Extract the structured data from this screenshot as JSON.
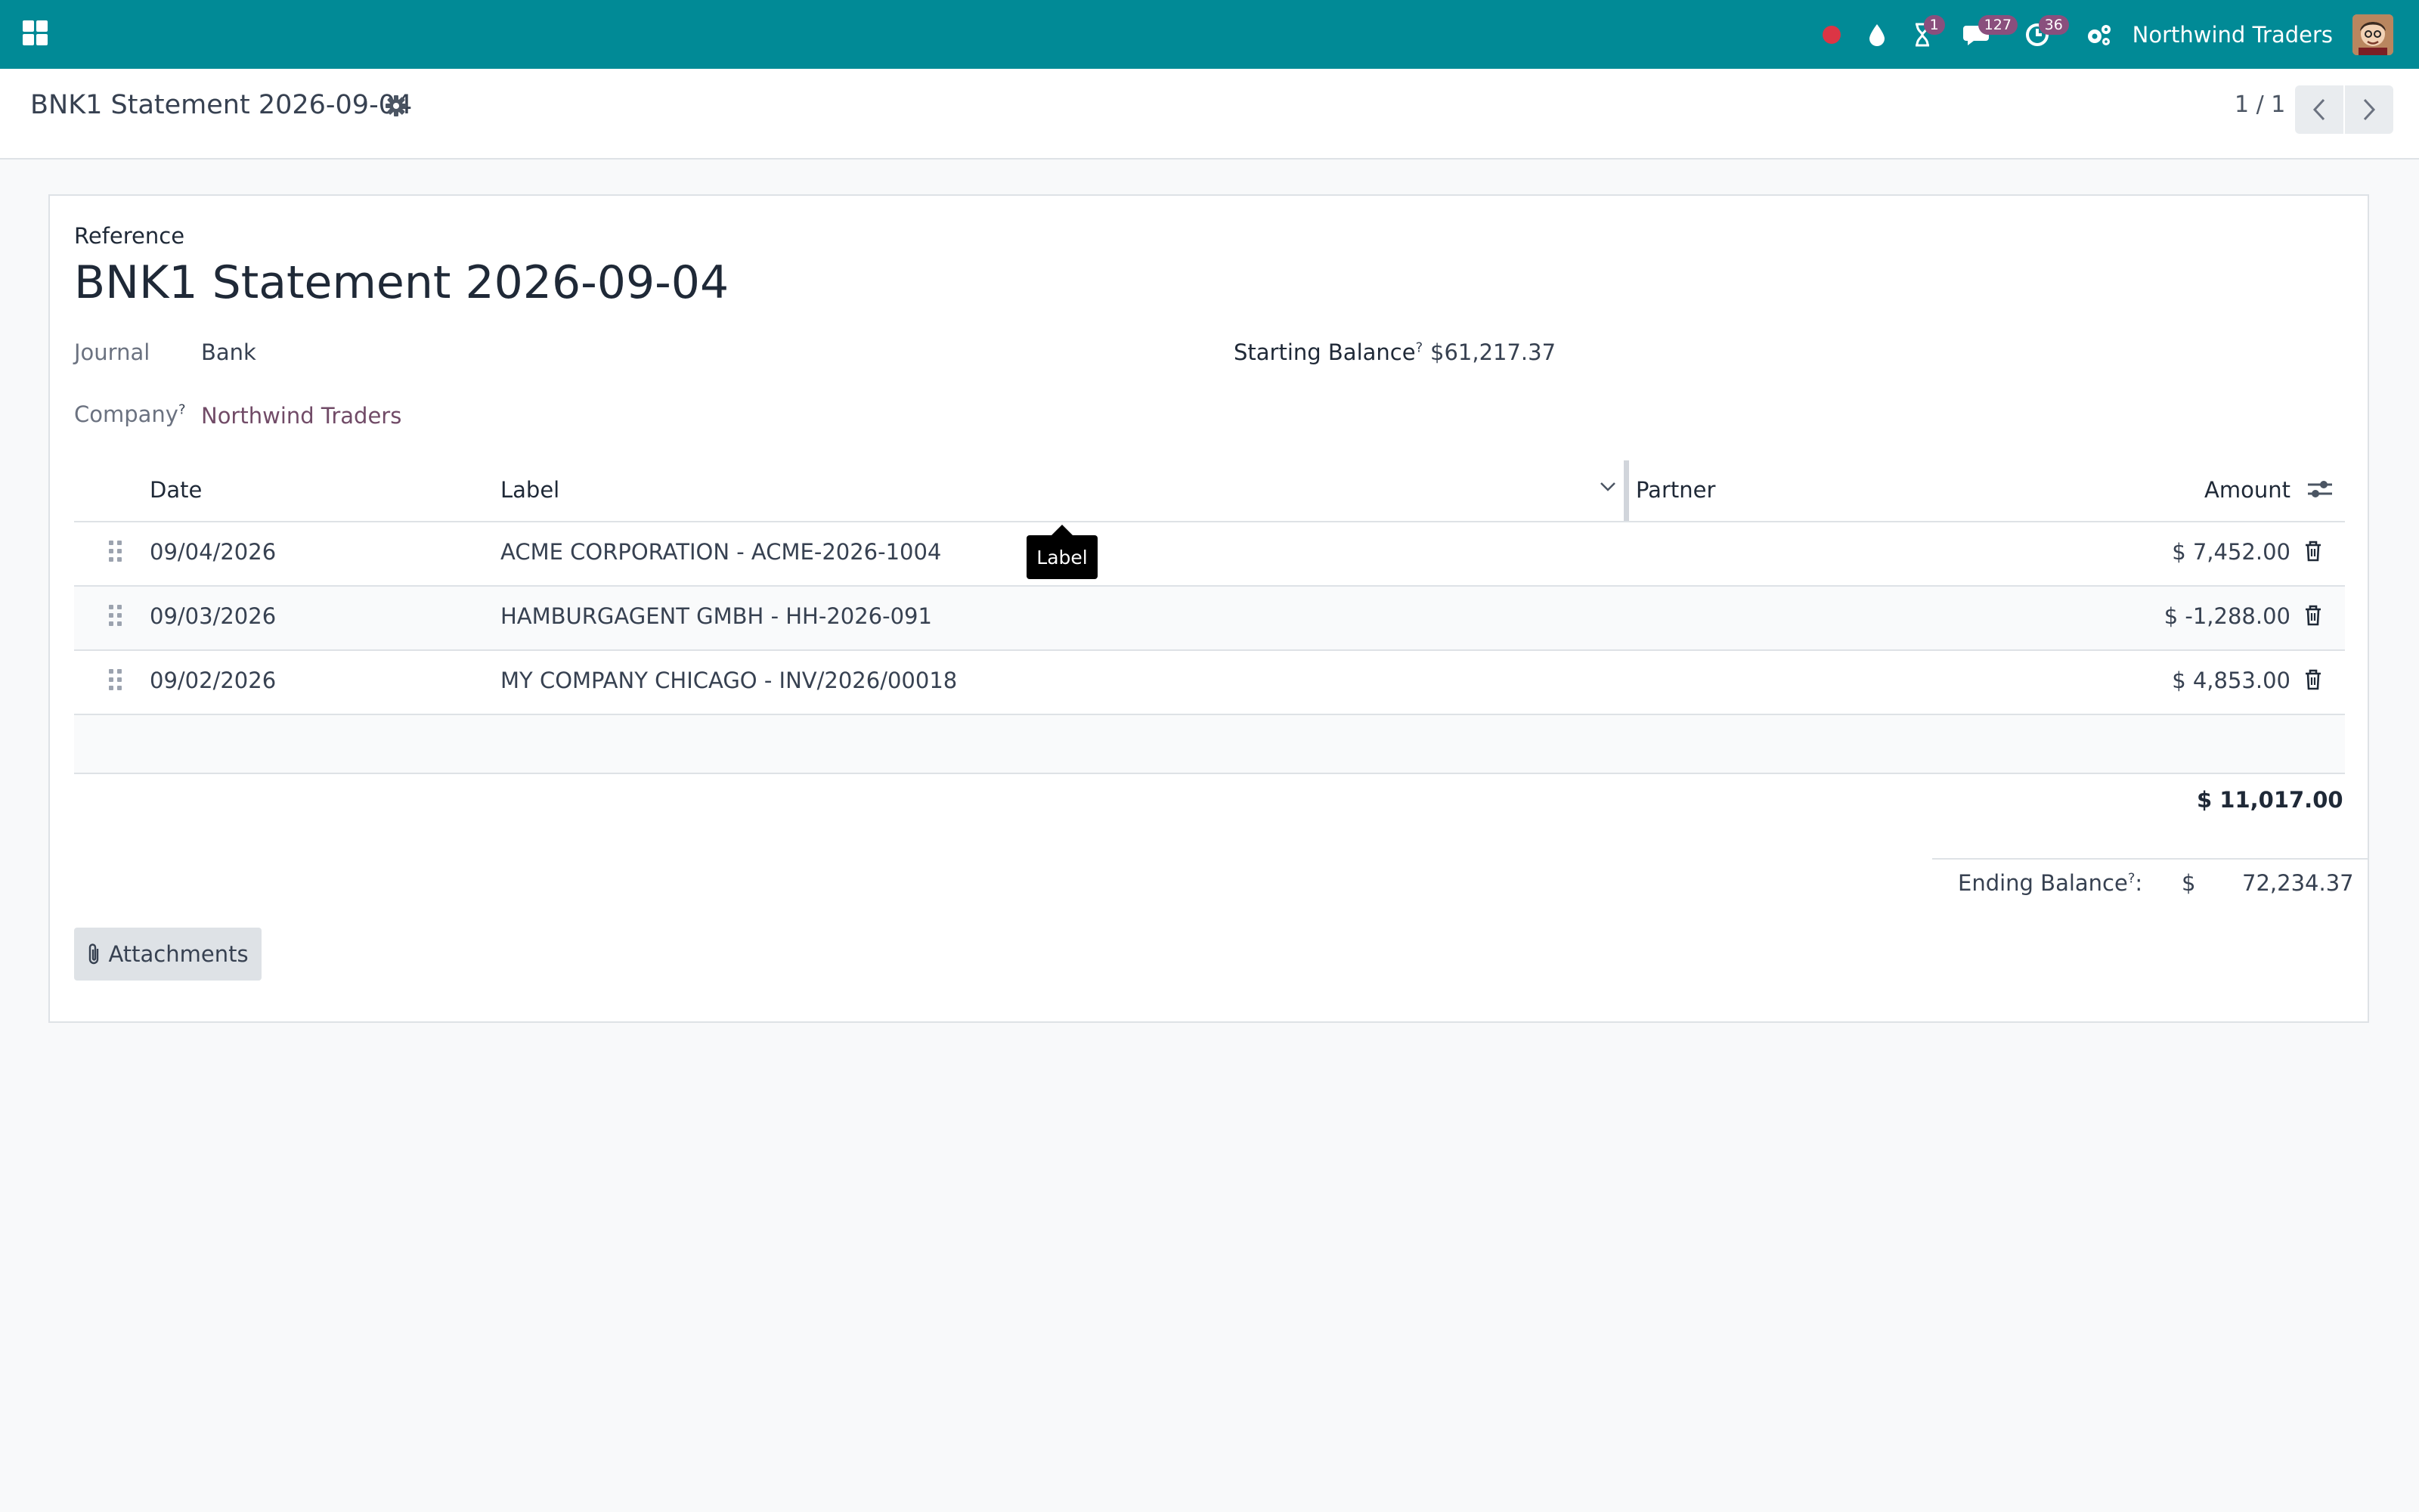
{
  "navbar": {
    "company": "Northwind Traders",
    "badges": {
      "activities": "1",
      "messages": "127",
      "timesheets": "36"
    },
    "colors": {
      "bar": "#018a96",
      "badge": "#8a4f7d",
      "record": "#dc3545"
    }
  },
  "control_panel": {
    "title": "BNK1 Statement 2026-09-04",
    "pager": "1 / 1"
  },
  "form": {
    "reference_label": "Reference",
    "reference_value": "BNK1 Statement 2026-09-04",
    "journal_label": "Journal",
    "journal_value": "Bank",
    "company_label": "Company",
    "company_value": "Northwind Traders",
    "starting_balance_label": "Starting Balance",
    "starting_balance_value": "$61,217.37",
    "help_marker": "?"
  },
  "table": {
    "columns": {
      "date": "Date",
      "label": "Label",
      "partner": "Partner",
      "amount": "Amount"
    },
    "rows": [
      {
        "date": "09/04/2026",
        "label": "ACME CORPORATION - ACME-2026-1004",
        "partner": "",
        "amount": "$ 7,452.00"
      },
      {
        "date": "09/03/2026",
        "label": "HAMBURGAGENT GMBH - HH-2026-091",
        "partner": "",
        "amount": "$ -1,288.00"
      },
      {
        "date": "09/02/2026",
        "label": "MY COMPANY CHICAGO - INV/2026/00018",
        "partner": "",
        "amount": "$ 4,853.00"
      }
    ],
    "total": "$ 11,017.00"
  },
  "ending": {
    "label": "Ending Balance",
    "suffix": ":",
    "currency": "$",
    "value": "72,234.37"
  },
  "attachments_label": "Attachments",
  "tooltip": "Label"
}
